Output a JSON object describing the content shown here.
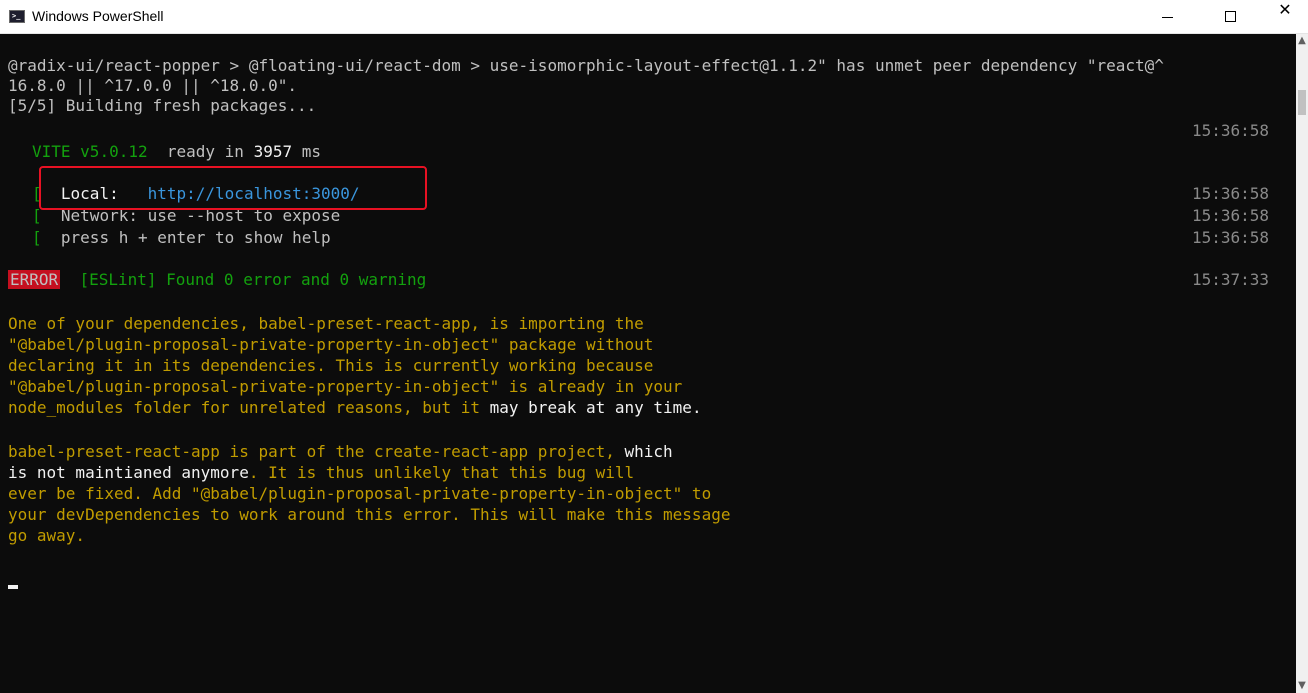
{
  "window": {
    "title": "Windows PowerShell",
    "icon_name": "powershell-icon",
    "buttons": {
      "minimize": "minimize-icon",
      "maximize": "maximize-icon",
      "close": "✕"
    }
  },
  "console": {
    "lines": [
      "@radix-ui/react-popper > @floating-ui/react-dom > use-isomorphic-layout-effect@1.1.2\" has unmet peer dependency \"react@^",
      "16.8.0 || ^17.0.0 || ^18.0.0\".",
      "[5/5] Building fresh packages..."
    ],
    "vite": {
      "name": "VITE",
      "version": "v5.0.12",
      "ready_text": "ready in",
      "ready_ms": "3957",
      "ready_unit": "ms",
      "timestamp": "15:36:58"
    },
    "server": {
      "local_label": "Local:",
      "local_url": "http://localhost:3000/",
      "network_label": "Network:",
      "network_text": "use --host to expose",
      "help_text": "press h + enter to show help",
      "bracket": "[",
      "timestamps": [
        "15:36:58",
        "15:36:58",
        "15:36:58"
      ]
    },
    "eslint": {
      "badge": "ERROR",
      "message": "[ESLint] Found 0 error and 0 warning",
      "timestamp": "15:37:33"
    },
    "warning_para1": [
      {
        "y": "One of your dependencies, babel-preset-react-app, is importing the"
      },
      {
        "y": "\"@babel/plugin-proposal-private-property-in-object\" package without"
      },
      {
        "y": "declaring it in its dependencies. This is currently working because"
      },
      {
        "y": "\"@babel/plugin-proposal-private-property-in-object\" is already in your"
      },
      {
        "y": "node_modules folder for unrelated reasons, but it ",
        "w": "may break at any time",
        "y2": "."
      }
    ],
    "warning_para2": [
      {
        "y": "babel-preset-react-app is part of the create-react-app project, ",
        "w": "which"
      },
      {
        "w": "is not maintianed anymore",
        "y": ". It is thus unlikely that this bug will"
      },
      {
        "y": "ever be fixed. Add \"@babel/plugin-proposal-private-property-in-object\" to"
      },
      {
        "y": "your devDependencies to work around this error. This will make this message"
      },
      {
        "y": "go away."
      }
    ]
  },
  "colors": {
    "background": "#0c0c0c",
    "text": "#c0c0c0",
    "green": "#13a10e",
    "cyan": "#3a96dd",
    "yellow": "#c19c00",
    "error_badge": "#c50f1f",
    "highlight_box": "#e81123"
  }
}
